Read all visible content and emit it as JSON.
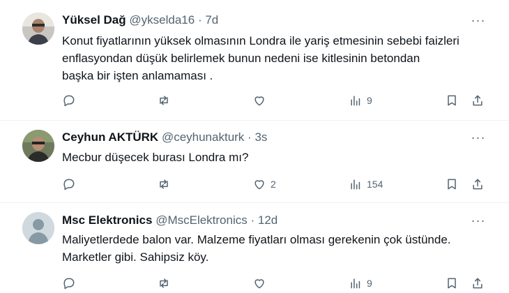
{
  "tweets": [
    {
      "name": "Yüksel Dağ",
      "handle": "@ykselda16",
      "separator": "·",
      "time": "7d",
      "text": "Konut fiyatlarının yüksek olmasının Londra ile yariş etmesinin sebebi faizleri\nenflasyondan düşük belirlemek bunun nedeni ise  kitlesinin betondan\nbaşka bir işten anlamaması .",
      "replies": "",
      "retweets": "",
      "likes": "",
      "views": "9"
    },
    {
      "name": "Ceyhun AKTÜRK",
      "handle": "@ceyhunakturk",
      "separator": "·",
      "time": "3s",
      "text": "Mecbur düşecek burası Londra mı?",
      "replies": "",
      "retweets": "",
      "likes": "2",
      "views": "154"
    },
    {
      "name": "Msc Elektronics",
      "handle": "@MscElektronics",
      "separator": "·",
      "time": "12d",
      "text": "Maliyetlerdede balon var. Malzeme fiyatları olması gerekenin çok üstünde.\nMarketler gibi. Sahipsiz köy.",
      "replies": "",
      "retweets": "",
      "likes": "",
      "views": "9"
    }
  ],
  "more_label": "···",
  "colors": {
    "text": "#0f1419",
    "muted": "#536471",
    "divider": "#eff3f4"
  }
}
